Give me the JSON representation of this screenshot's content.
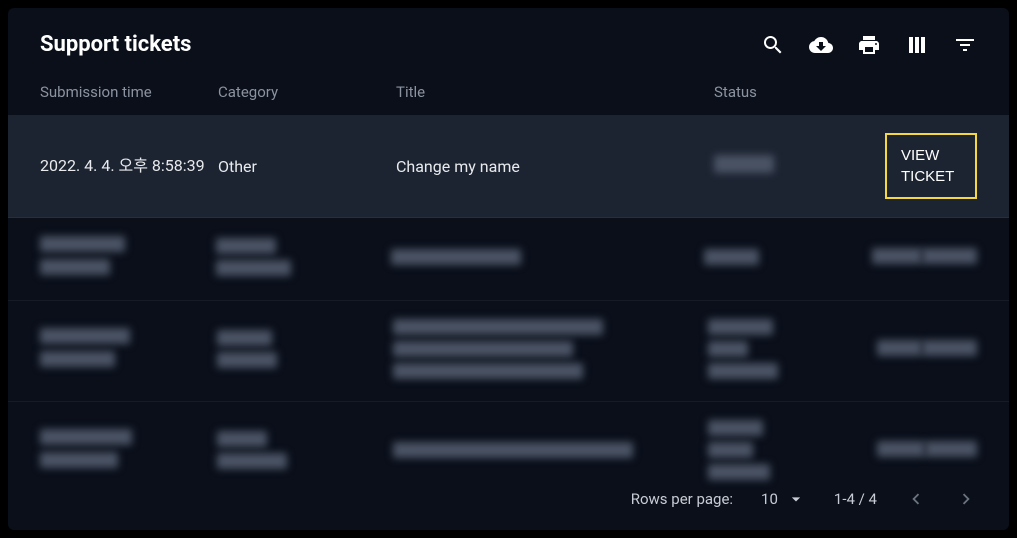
{
  "header": {
    "title": "Support tickets"
  },
  "columns": {
    "time": "Submission time",
    "category": "Category",
    "title": "Title",
    "status": "Status"
  },
  "rows": [
    {
      "time": "2022. 4. 4. 오후 8:58:39",
      "category": "Other",
      "title": "Change my name",
      "status": "",
      "action": "VIEW TICKET",
      "highlighted": true,
      "blurred": false
    }
  ],
  "footer": {
    "rows_label": "Rows per page:",
    "rows_value": "10",
    "range": "1-4 / 4"
  }
}
